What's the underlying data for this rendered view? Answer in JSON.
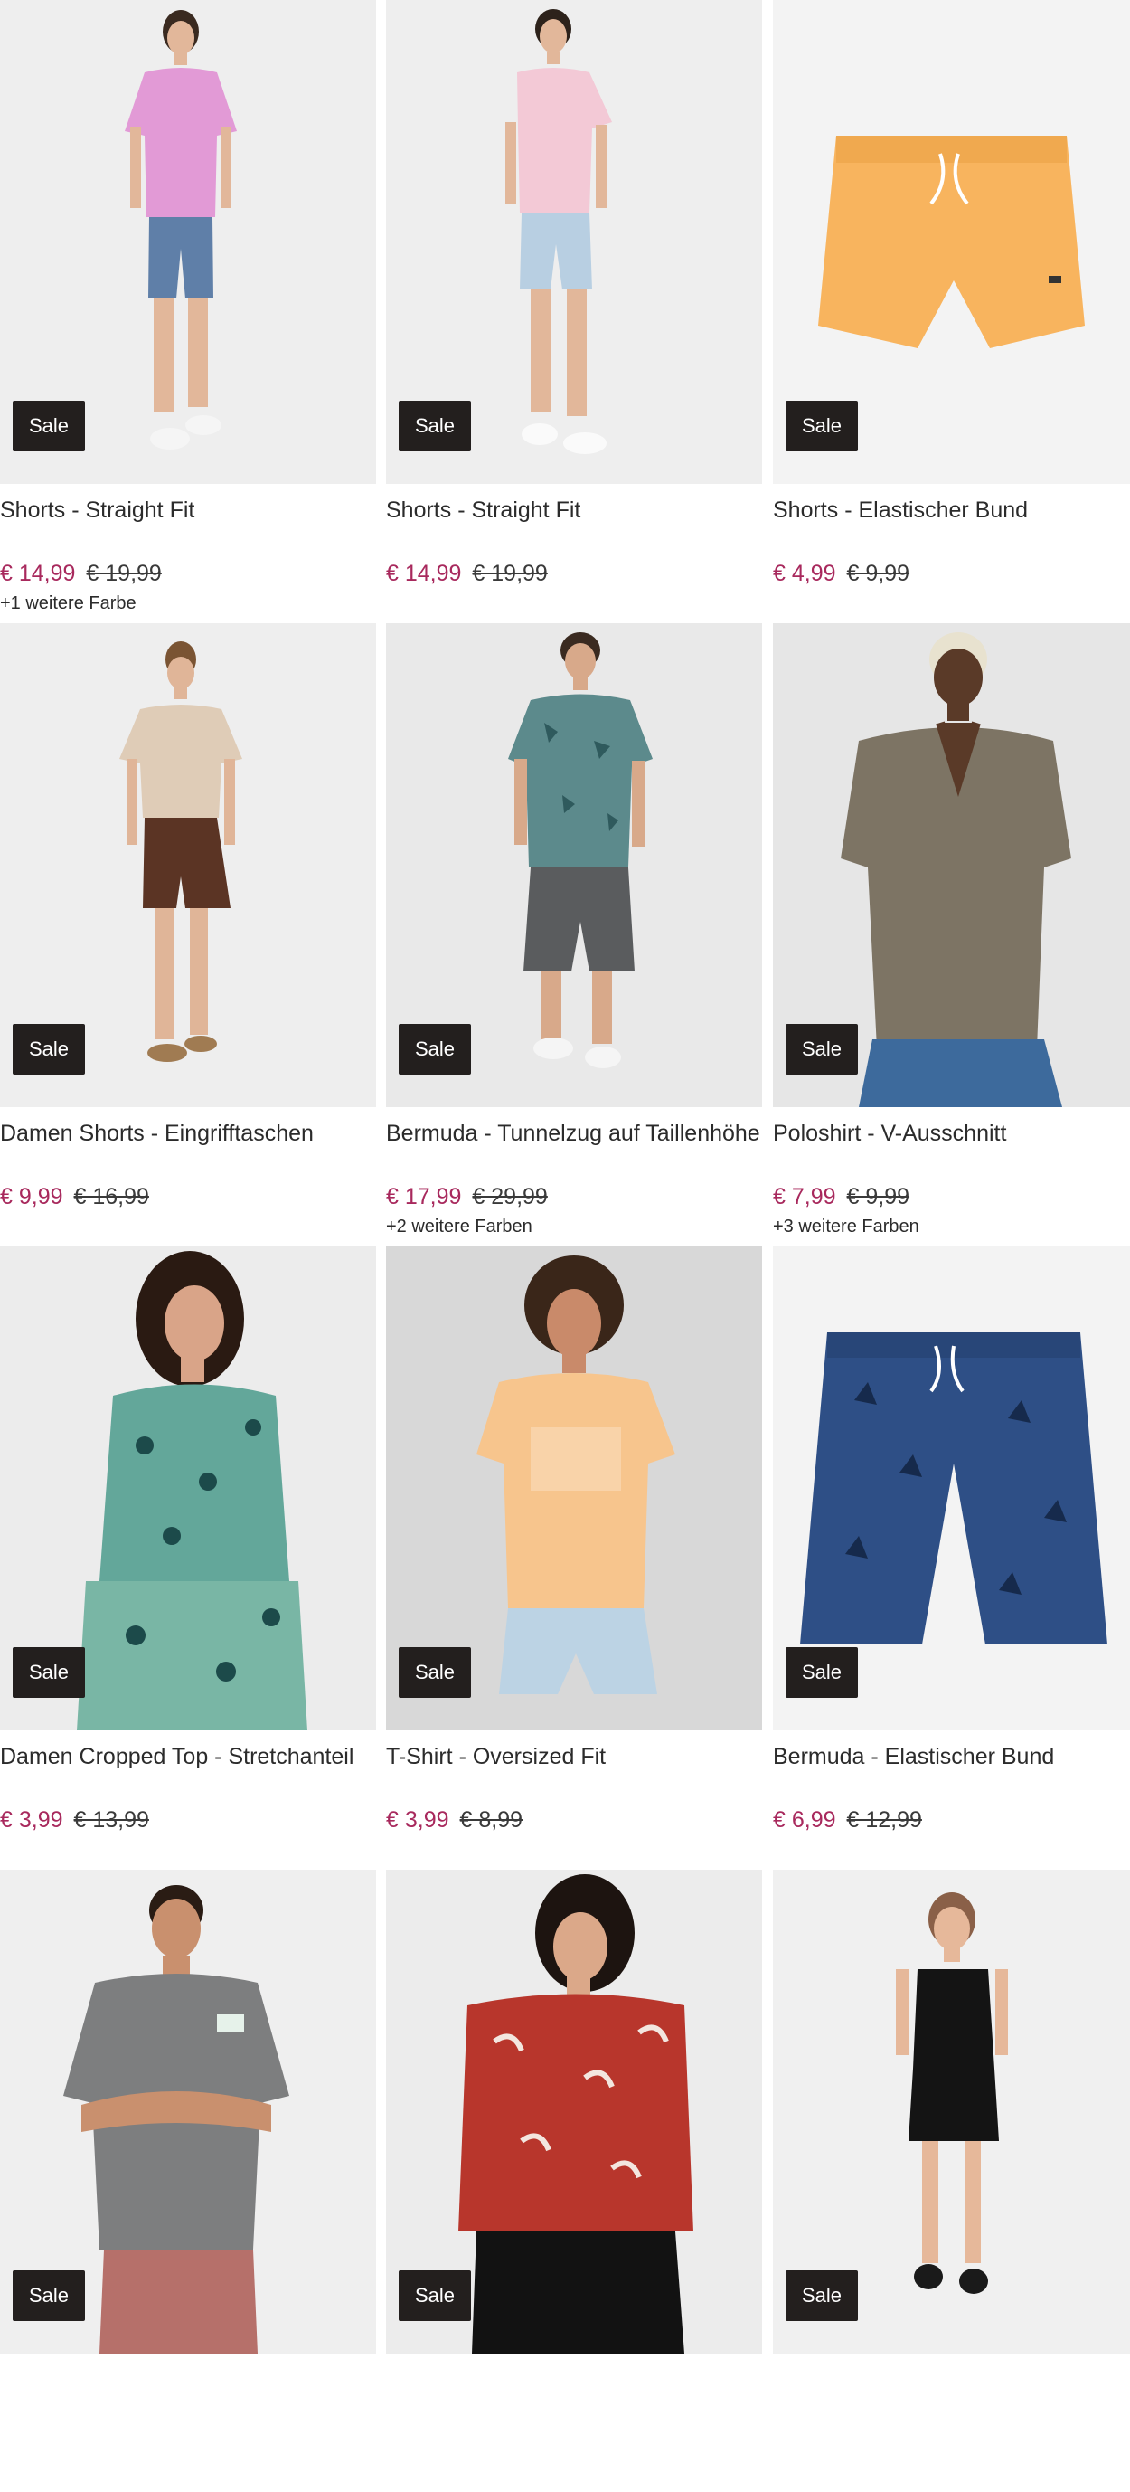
{
  "badge_label": "Sale",
  "colors": {
    "price_current": "#a8295d",
    "price_old": "#3a3a3a",
    "badge_bg": "#231f1e",
    "image_bg": "#ededed"
  },
  "products": [
    {
      "title": "Shorts - Straight Fit",
      "price": "€ 14,99",
      "old_price": "€ 19,99",
      "more_colors": "+1 weitere Farbe",
      "image": "woman-pink-tshirt-denim-shorts"
    },
    {
      "title": "Shorts - Straight Fit",
      "price": "€ 14,99",
      "old_price": "€ 19,99",
      "more_colors": "",
      "image": "woman-light-pink-tshirt-light-denim-shorts"
    },
    {
      "title": "Shorts - Elastischer Bund",
      "price": "€ 4,99",
      "old_price": "€ 9,99",
      "more_colors": "",
      "image": "orange-shorts-flatlay"
    },
    {
      "title": "Damen Shorts - Eingrifftaschen",
      "price": "€ 9,99",
      "old_price": "€ 16,99",
      "more_colors": "",
      "image": "woman-beige-top-brown-shorts"
    },
    {
      "title": "Bermuda - Tunnelzug auf Taillenhöhe",
      "price": "€ 17,99",
      "old_price": "€ 29,99",
      "more_colors": "+2 weitere Farben",
      "image": "man-printed-shirt-grey-bermuda"
    },
    {
      "title": "Poloshirt - V-Ausschnitt",
      "price": "€ 7,99",
      "old_price": "€ 9,99",
      "more_colors": "+3 weitere Farben",
      "image": "woman-olive-ribbed-polo"
    },
    {
      "title": "Damen Cropped Top - Stretchanteil",
      "price": "€ 3,99",
      "old_price": "€ 13,99",
      "more_colors": "",
      "image": "woman-green-patterned-top"
    },
    {
      "title": "T-Shirt - Oversized Fit",
      "price": "€ 3,99",
      "old_price": "€ 8,99",
      "more_colors": "",
      "image": "woman-peach-printed-tshirt"
    },
    {
      "title": "Bermuda - Elastischer Bund",
      "price": "€ 6,99",
      "old_price": "€ 12,99",
      "more_colors": "",
      "image": "blue-palm-print-bermuda-flatlay"
    },
    {
      "title": "",
      "price": "",
      "old_price": "",
      "more_colors": "",
      "image": "man-grey-tshirt"
    },
    {
      "title": "",
      "price": "",
      "old_price": "",
      "more_colors": "",
      "image": "woman-red-patterned-top"
    },
    {
      "title": "",
      "price": "",
      "old_price": "",
      "more_colors": "",
      "image": "woman-black-strappy-playsuit"
    }
  ]
}
